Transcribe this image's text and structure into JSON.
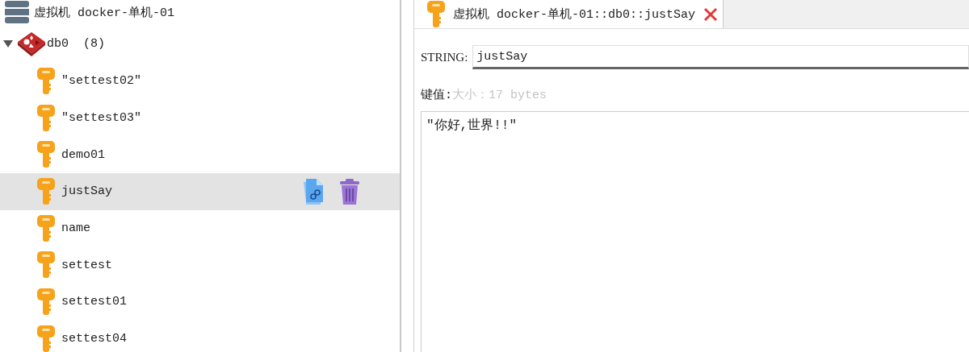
{
  "connection": {
    "label": "虚拟机 docker-单机-01"
  },
  "database": {
    "label": "db0",
    "count": "(8)",
    "expanded": true,
    "keys": [
      {
        "name": "\"settest02\"",
        "selected": false
      },
      {
        "name": "\"settest03\"",
        "selected": false
      },
      {
        "name": "demo01",
        "selected": false
      },
      {
        "name": "justSay",
        "selected": true
      },
      {
        "name": "name",
        "selected": false
      },
      {
        "name": "settest",
        "selected": false
      },
      {
        "name": "settest01",
        "selected": false
      },
      {
        "name": "settest04",
        "selected": false
      }
    ]
  },
  "tabs": [
    {
      "title": "虚拟机 docker-单机-01::db0::justSay",
      "selected": true
    }
  ],
  "editor": {
    "type_label": "STRING:",
    "key_name": "justSay",
    "value_label": "键值:",
    "size": "大小：17 bytes",
    "value": "\"你好,世界!!\""
  }
}
